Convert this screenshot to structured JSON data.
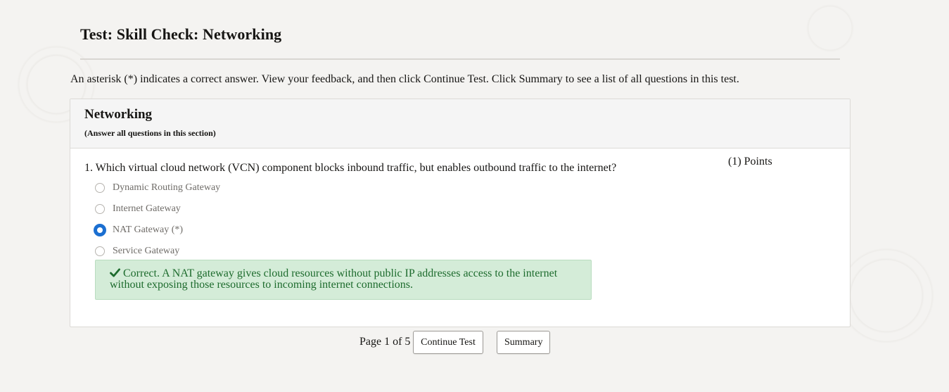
{
  "page": {
    "title": "Test: Skill Check: Networking",
    "instructions": "An asterisk (*) indicates a correct answer. View your feedback, and then click Continue Test. Click Summary to see a list of all questions in this test."
  },
  "section": {
    "title": "Networking",
    "subtitle": "(Answer all questions in this section)"
  },
  "question": {
    "text": "1. Which virtual cloud network (VCN) component blocks inbound traffic, but enables outbound traffic to the internet?",
    "points": "(1) Points",
    "options": [
      {
        "label": "Dynamic Routing Gateway",
        "selected": false
      },
      {
        "label": "Internet Gateway",
        "selected": false
      },
      {
        "label": "NAT Gateway (*)",
        "selected": true
      },
      {
        "label": "Service Gateway",
        "selected": false
      }
    ],
    "feedback": {
      "icon": "check-icon",
      "line1": "Correct. A NAT gateway gives cloud resources without public IP addresses access to the internet",
      "line2": "without exposing those resources to incoming internet connections."
    }
  },
  "footer": {
    "pager": "Page 1 of 5",
    "continue_label": "Continue Test",
    "summary_label": "Summary"
  },
  "colors": {
    "accent": "#1b6fd1",
    "feedback_bg": "#d4ecd8",
    "feedback_text": "#1d6b2d"
  }
}
